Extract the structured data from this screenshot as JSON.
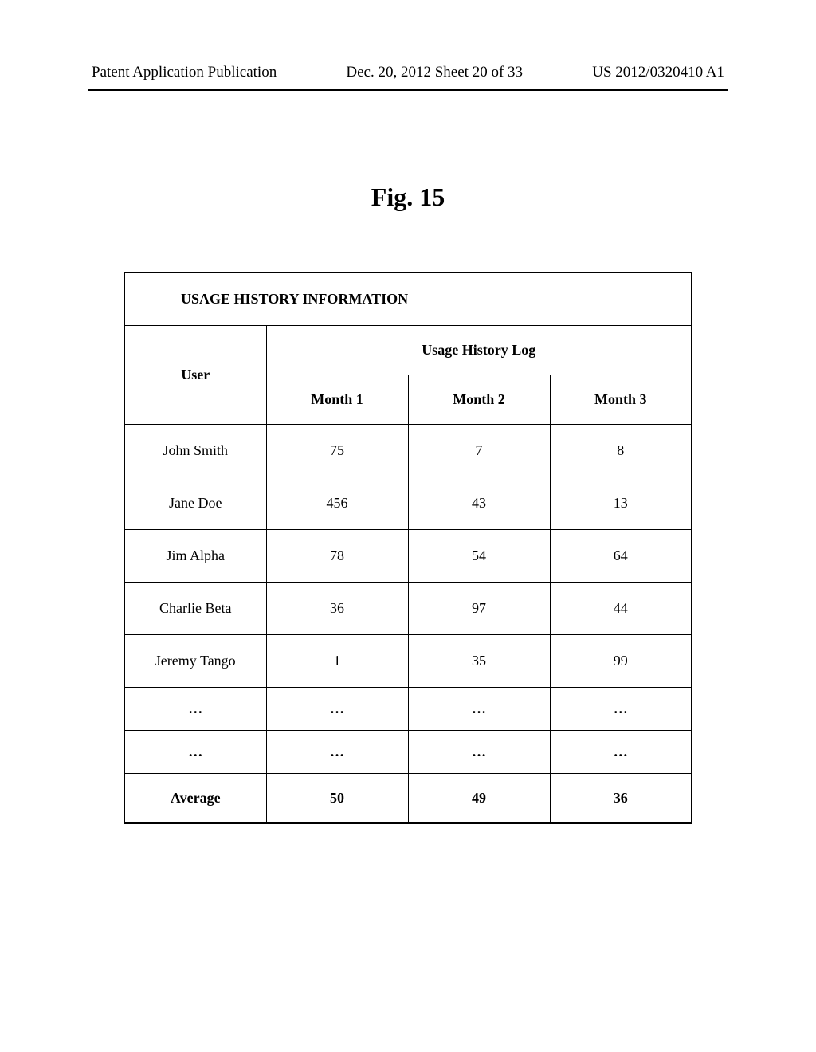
{
  "header": {
    "left": "Patent Application Publication",
    "center": "Dec. 20, 2012  Sheet 20 of 33",
    "right": "US 2012/0320410 A1"
  },
  "figure_label": "Fig. 15",
  "table": {
    "title": "USAGE HISTORY INFORMATION",
    "user_header": "User",
    "log_header": "Usage History Log",
    "months": [
      "Month 1",
      "Month 2",
      "Month 3"
    ],
    "rows": [
      {
        "user": "John Smith",
        "m1": "75",
        "m2": "7",
        "m3": "8"
      },
      {
        "user": "Jane Doe",
        "m1": "456",
        "m2": "43",
        "m3": "13"
      },
      {
        "user": "Jim Alpha",
        "m1": "78",
        "m2": "54",
        "m3": "64"
      },
      {
        "user": "Charlie Beta",
        "m1": "36",
        "m2": "97",
        "m3": "44"
      },
      {
        "user": "Jeremy Tango",
        "m1": "1",
        "m2": "35",
        "m3": "99"
      }
    ],
    "ellipsis": "…",
    "average": {
      "label": "Average",
      "m1": "50",
      "m2": "49",
      "m3": "36"
    }
  }
}
